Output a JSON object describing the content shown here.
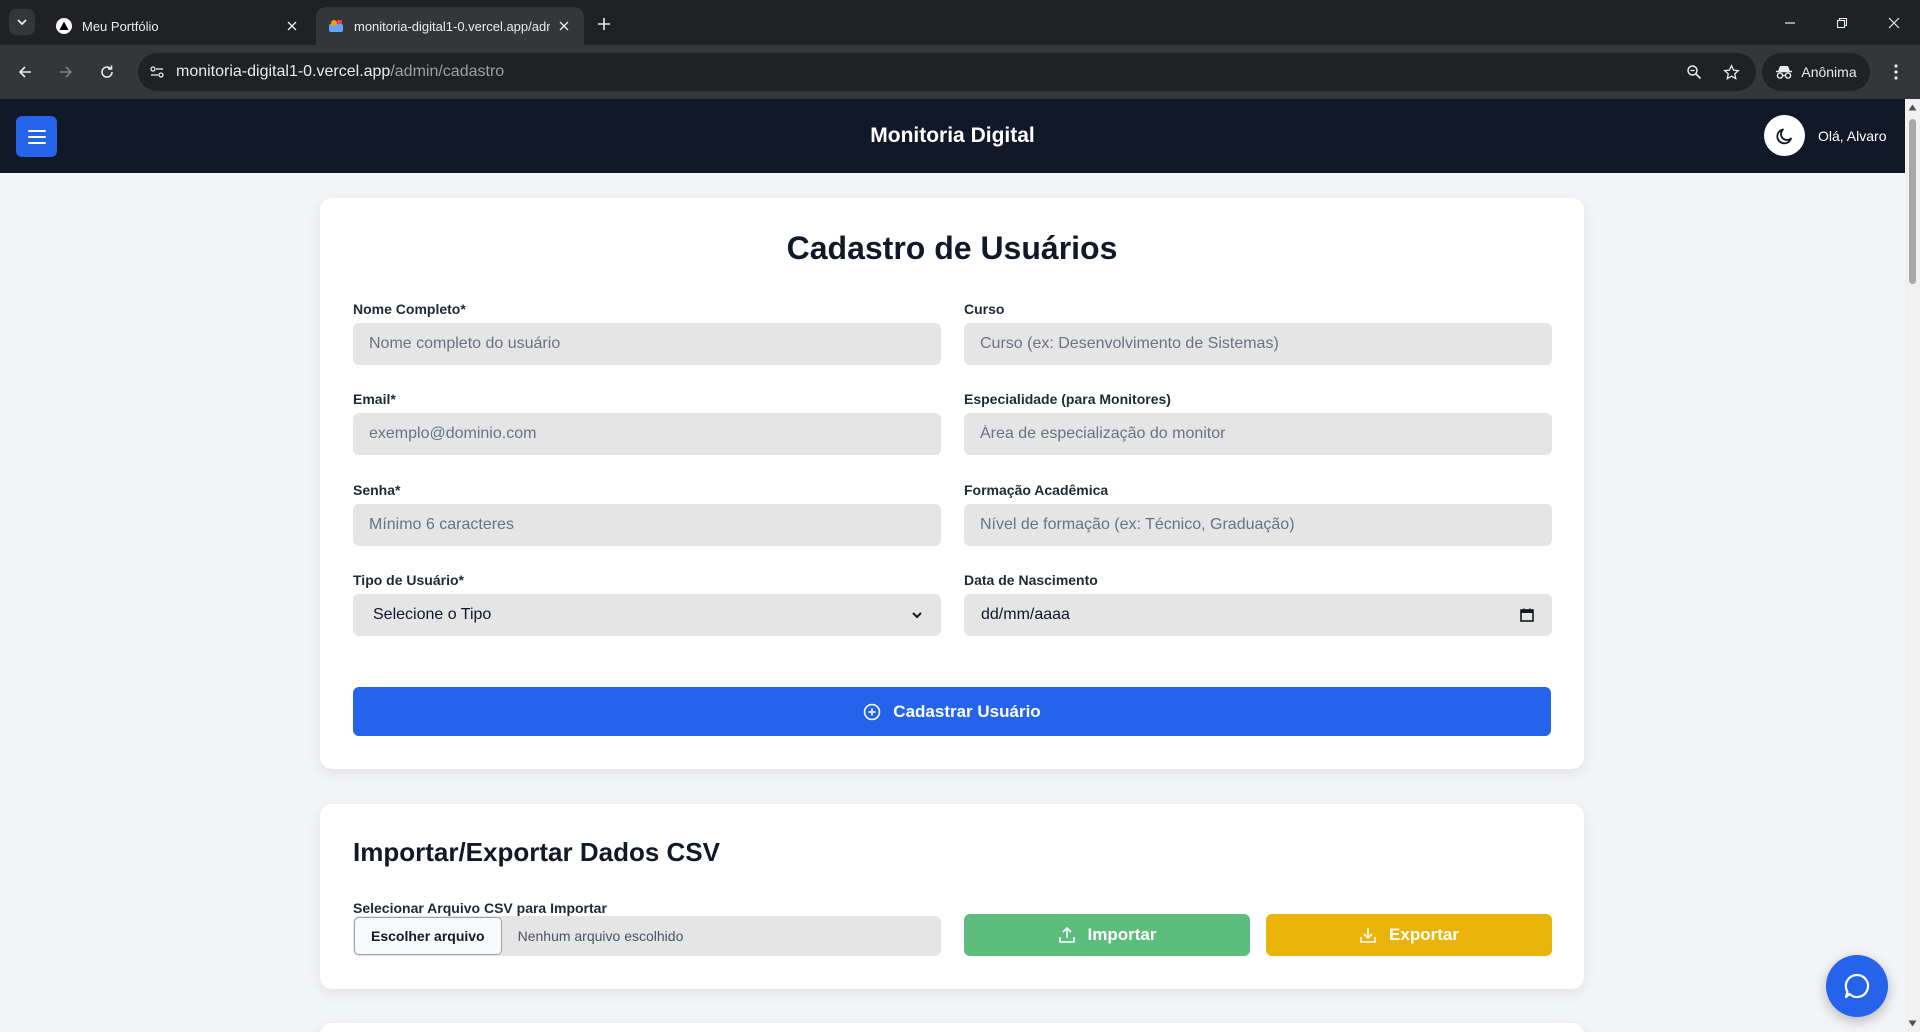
{
  "browser": {
    "tabs": [
      {
        "title": "Meu Portfólio",
        "icon": "triangle-logo-icon",
        "active": false
      },
      {
        "title": "monitoria-digital1-0.vercel.app/admin/cadastro",
        "icon": "site-favicon-icon",
        "active": true
      }
    ],
    "url_host": "monitoria-digital1-0.vercel.app",
    "url_path": "/admin/cadastro",
    "profile_label": "Anônima"
  },
  "header": {
    "title": "Monitoria Digital",
    "greeting": "Olá, Alvaro"
  },
  "registration": {
    "title": "Cadastro de Usuários",
    "fields": {
      "name": {
        "label": "Nome Completo*",
        "placeholder": "Nome completo do usuário"
      },
      "course": {
        "label": "Curso",
        "placeholder": "Curso (ex: Desenvolvimento de Sistemas)"
      },
      "email": {
        "label": "Email*",
        "placeholder": "exemplo@dominio.com"
      },
      "specialty": {
        "label": "Especialidade (para Monitores)",
        "placeholder": "Área de especialização do monitor"
      },
      "password": {
        "label": "Senha*",
        "placeholder": "Mínimo 6 caracteres"
      },
      "education": {
        "label": "Formação Acadêmica",
        "placeholder": "Nível de formação (ex: Técnico, Graduação)"
      },
      "user_type": {
        "label": "Tipo de Usuário*",
        "selected": "Selecione o Tipo"
      },
      "birthdate": {
        "label": "Data de Nascimento",
        "value": "dd/mm/aaaa"
      }
    },
    "submit_label": "Cadastrar Usuário"
  },
  "csv": {
    "title": "Importar/Exportar Dados CSV",
    "file_label": "Selecionar Arquivo CSV para Importar",
    "choose_label": "Escolher arquivo",
    "no_file_text": "Nenhum arquivo escolhido",
    "import_label": "Importar",
    "export_label": "Exportar"
  },
  "colors": {
    "header_bg": "#111827",
    "primary": "#2563eb",
    "import_green": "#5cbd7d",
    "export_yellow": "#eab308"
  }
}
